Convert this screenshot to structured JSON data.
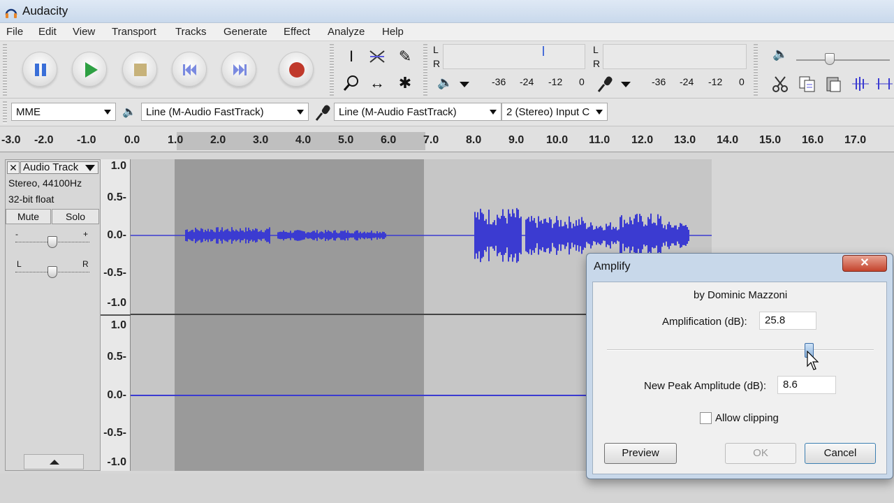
{
  "window": {
    "title": "Audacity"
  },
  "menu": [
    "File",
    "Edit",
    "View",
    "Transport",
    "Tracks",
    "Generate",
    "Effect",
    "Analyze",
    "Help"
  ],
  "meters": {
    "left_channel": "L",
    "right_channel": "R",
    "playback_scale": [
      "-36",
      "-24",
      "-12",
      "0"
    ],
    "record_scale": [
      "-36",
      "-24",
      "-12",
      "0"
    ]
  },
  "device_toolbar": {
    "host": "MME",
    "output_device": "Line (M-Audio FastTrack)",
    "input_device": "Line (M-Audio FastTrack)",
    "channels": "2 (Stereo) Input C"
  },
  "ruler_labels": [
    "-3.0",
    "-2.0",
    "-1.0",
    "0.0",
    "1.0",
    "2.0",
    "3.0",
    "4.0",
    "5.0",
    "6.0",
    "7.0",
    "8.0",
    "9.0",
    "10.0",
    "11.0",
    "12.0",
    "13.0",
    "14.0",
    "15.0",
    "16.0",
    "17.0"
  ],
  "track": {
    "name": "Audio Track",
    "format": "Stereo, 44100Hz",
    "bit_depth": "32-bit float",
    "mute_label": "Mute",
    "solo_label": "Solo",
    "gain_min": "-",
    "gain_max": "+",
    "pan_left": "L",
    "pan_right": "R",
    "amplitude_labels": [
      "1.0",
      "0.5-",
      "0.0-",
      "-0.5-",
      "-1.0"
    ]
  },
  "amplify_dialog": {
    "title": "Amplify",
    "author": "by Dominic Mazzoni",
    "amplification_label": "Amplification (dB):",
    "amplification_value": "25.8",
    "peak_label": "New Peak Amplitude (dB):",
    "peak_value": "8.6",
    "allow_clipping_label": "Allow clipping",
    "allow_clipping_checked": false,
    "slider_level_fraction": 0.76,
    "preview_label": "Preview",
    "ok_label": "OK",
    "cancel_label": "Cancel",
    "close_glyph": "✕"
  },
  "colors": {
    "waveform": "#3b3bd1",
    "record": "#c0392b",
    "play": "#2ea043",
    "pause": "#3a6fd8"
  }
}
